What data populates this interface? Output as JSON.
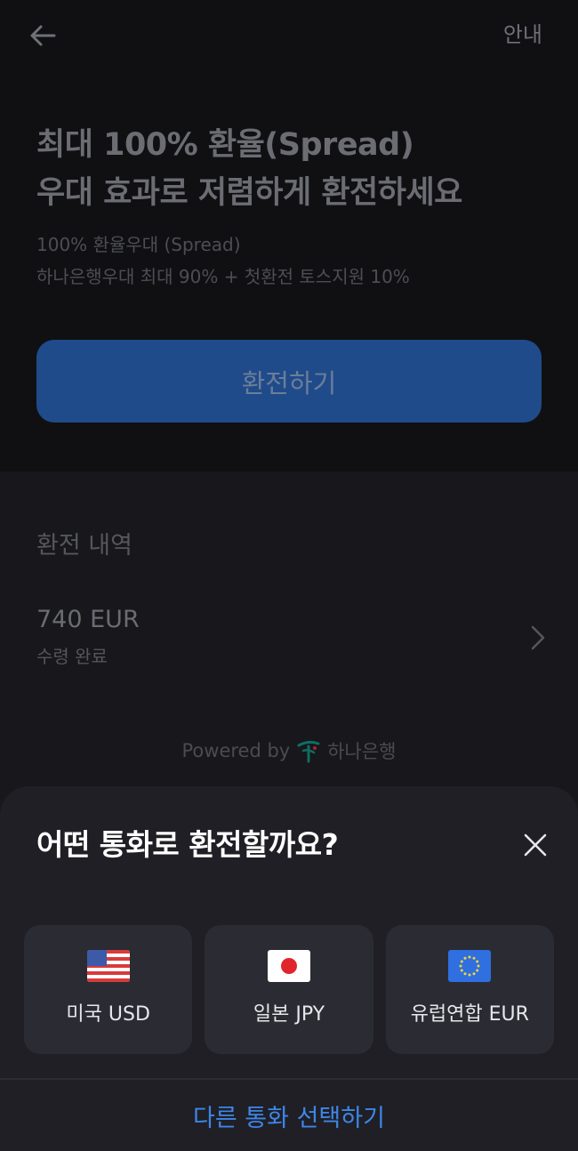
{
  "header": {
    "back_icon": "arrow-left-icon",
    "info_label": "안내"
  },
  "promo": {
    "headline_line1": "최대 100% 환율(Spread)",
    "headline_line2": "우대 효과로 저렴하게 환전하세요",
    "sub_line1": "100% 환율우대 (Spread)",
    "sub_line2": "하나은행우대 최대 90% + 첫환전 토스지원 10%",
    "cta_label": "환전하기"
  },
  "history": {
    "title": "환전 내역",
    "items": [
      {
        "amount": "740 EUR",
        "status": "수령 완료"
      }
    ]
  },
  "footer": {
    "powered_by": "Powered by",
    "bank_name": "하나은행",
    "bank_logo_color": "#0f7a6b"
  },
  "sheet": {
    "title": "어떤 통화로 환전할까요?",
    "close_icon": "close-icon",
    "currencies": [
      {
        "label": "미국 USD",
        "flag": "us-flag-icon"
      },
      {
        "label": "일본 JPY",
        "flag": "jp-flag-icon"
      },
      {
        "label": "유럽연합 EUR",
        "flag": "eu-flag-icon"
      }
    ],
    "other_label": "다른 통화 선택하기"
  },
  "colors": {
    "accent": "#3e86e8",
    "cta_dimmed": "#1f4b8a",
    "sheet_bg": "#1f1f25",
    "card_bg": "#2b2c33"
  }
}
